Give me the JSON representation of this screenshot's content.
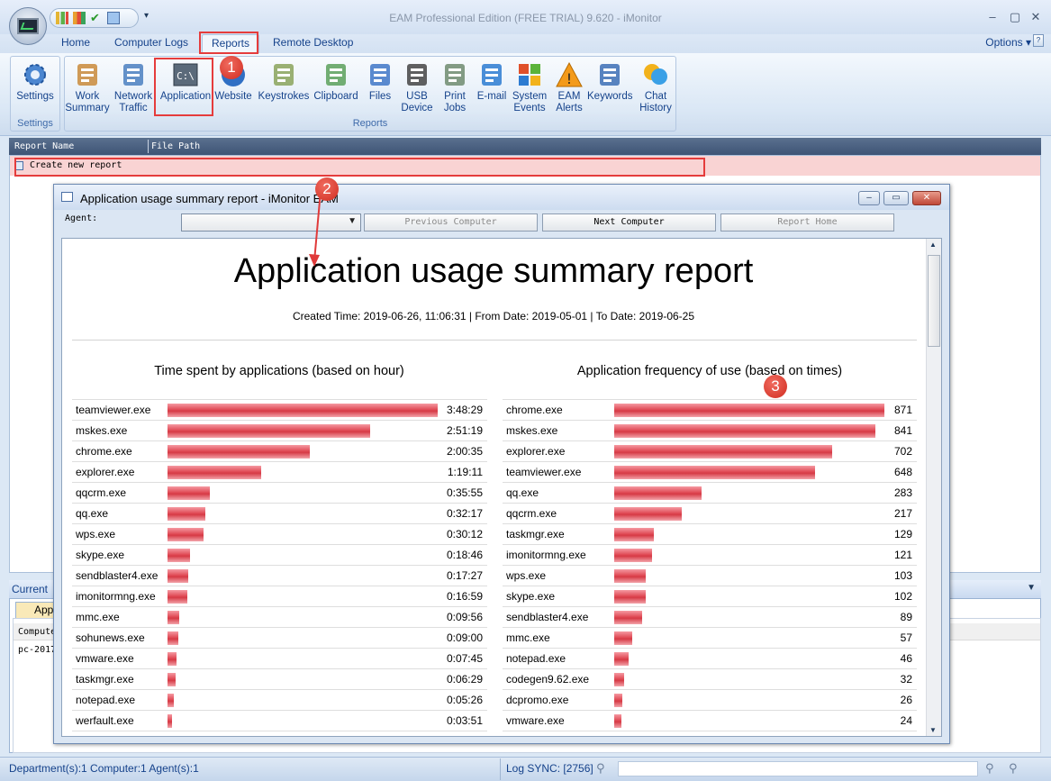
{
  "window": {
    "title": "EAM Professional Edition (FREE TRIAL) 9.620  -  iMonitor"
  },
  "menu": {
    "tabs": [
      "Home",
      "Computer Logs",
      "Reports",
      "Remote Desktop"
    ],
    "options_label": "Options"
  },
  "ribbon": {
    "settings_group": {
      "label": "Settings",
      "button": "Settings"
    },
    "reports_group": {
      "label": "Reports",
      "buttons": [
        {
          "line1": "Work",
          "line2": "Summary",
          "icon": "work-summary-icon"
        },
        {
          "line1": "Network",
          "line2": "Traffic",
          "icon": "network-traffic-icon"
        },
        {
          "line1": "Application",
          "line2": "",
          "icon": "application-icon"
        },
        {
          "line1": "Website",
          "line2": "",
          "icon": "website-icon"
        },
        {
          "line1": "Keystrokes",
          "line2": "",
          "icon": "keystrokes-icon"
        },
        {
          "line1": "Clipboard",
          "line2": "",
          "icon": "clipboard-icon"
        },
        {
          "line1": "Files",
          "line2": "",
          "icon": "files-icon"
        },
        {
          "line1": "USB",
          "line2": "Device",
          "icon": "usb-icon"
        },
        {
          "line1": "Print",
          "line2": "Jobs",
          "icon": "printer-icon"
        },
        {
          "line1": "E-mail",
          "line2": "",
          "icon": "email-icon"
        },
        {
          "line1": "System",
          "line2": "Events",
          "icon": "windows-icon"
        },
        {
          "line1": "EAM",
          "line2": "Alerts",
          "icon": "warning-icon"
        },
        {
          "line1": "Keywords",
          "line2": "",
          "icon": "keywords-icon"
        },
        {
          "line1": "Chat",
          "line2": "History",
          "icon": "chat-icon"
        }
      ]
    }
  },
  "report_list": {
    "columns": [
      "Report Name",
      "File Path"
    ],
    "rows": [
      "Create new report"
    ]
  },
  "bottom_panel": {
    "title": "Current",
    "tab": "App",
    "col": "Compute",
    "row": "pc-2017"
  },
  "status": {
    "left": "Department(s):1  Computer:1  Agent(s):1",
    "sync": "Log SYNC: [2756]"
  },
  "dialog": {
    "title": "Application usage summary report - iMonitor EAM",
    "agent_label": "Agent:",
    "buttons": {
      "prev": "Previous Computer",
      "next": "Next Computer",
      "home": "Report Home"
    },
    "report_title": "Application usage summary report",
    "created": "Created Time: 2019-06-26, 11:06:31 | From Date: 2019-05-01 | To Date: 2019-06-25",
    "left_title": "Time spent by applications (based on hour)",
    "right_title": "Application frequency of use (based on times)"
  },
  "annotations": [
    "1",
    "2",
    "3"
  ],
  "chart_data": [
    {
      "type": "bar",
      "title": "Time spent by applications (based on hour)",
      "categories": [
        "teamviewer.exe",
        "mskes.exe",
        "chrome.exe",
        "explorer.exe",
        "qqcrm.exe",
        "qq.exe",
        "wps.exe",
        "skype.exe",
        "sendblaster4.exe",
        "imonitormng.exe",
        "mmc.exe",
        "sohunews.exe",
        "vmware.exe",
        "taskmgr.exe",
        "notepad.exe",
        "werfault.exe"
      ],
      "labels": [
        "3:48:29",
        "2:51:19",
        "2:00:35",
        "1:19:11",
        "0:35:55",
        "0:32:17",
        "0:30:12",
        "0:18:46",
        "0:17:27",
        "0:16:59",
        "0:09:56",
        "0:09:00",
        "0:07:45",
        "0:06:29",
        "0:05:26",
        "0:03:51"
      ],
      "values": [
        13709,
        10279,
        7235,
        4751,
        2155,
        1937,
        1812,
        1126,
        1047,
        1019,
        596,
        540,
        465,
        389,
        326,
        231
      ]
    },
    {
      "type": "bar",
      "title": "Application frequency of use (based on times)",
      "categories": [
        "chrome.exe",
        "mskes.exe",
        "explorer.exe",
        "teamviewer.exe",
        "qq.exe",
        "qqcrm.exe",
        "taskmgr.exe",
        "imonitormng.exe",
        "wps.exe",
        "skype.exe",
        "sendblaster4.exe",
        "mmc.exe",
        "notepad.exe",
        "codegen9.62.exe",
        "dcpromo.exe",
        "vmware.exe"
      ],
      "values": [
        871,
        841,
        702,
        648,
        283,
        217,
        129,
        121,
        103,
        102,
        89,
        57,
        46,
        32,
        26,
        24
      ]
    }
  ]
}
